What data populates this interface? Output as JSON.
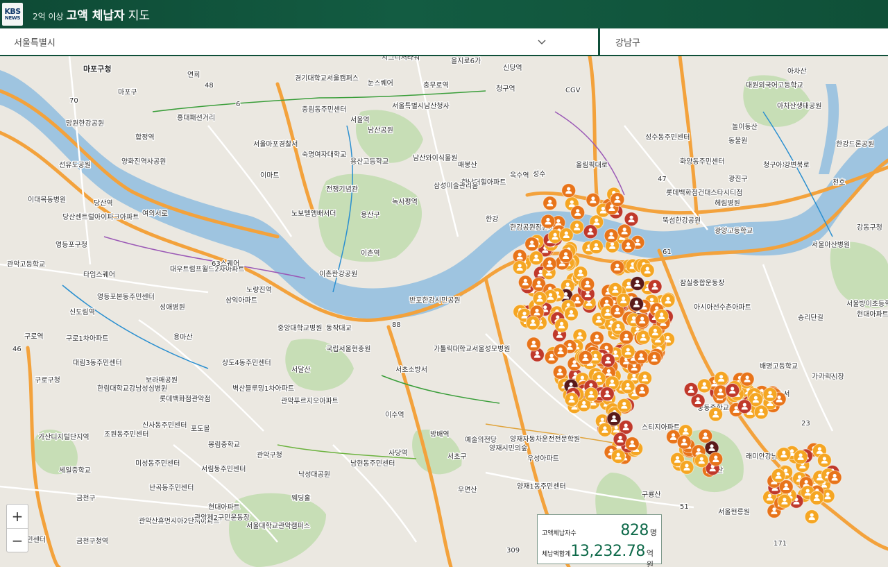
{
  "header": {
    "logo_line1": "KBS",
    "logo_line2": "NEWS",
    "title_pre": "2억 이상",
    "title_main": "고액 체납자",
    "title_post": "지도"
  },
  "filters": {
    "city": "서울특별시",
    "district": "강남구"
  },
  "summary": {
    "count_label": "고액체납자수",
    "count_value": "828",
    "count_unit": "명",
    "amount_label": "체납액합계",
    "amount_value": "13,232.78",
    "amount_unit": "억원"
  },
  "zoom": {
    "in": "+",
    "out": "−"
  },
  "colors": {
    "header": "#135c42",
    "river": "#9fc3e0",
    "marker_orange": "#f5a623",
    "marker_dark_orange": "#e8741a",
    "marker_red": "#c0392b",
    "marker_dark": "#5a1a1a",
    "highway": "#f39c32",
    "park": "#c9dfb8"
  },
  "map_labels": [
    "마포구청",
    "마포구",
    "홍대패션거리",
    "합정역",
    "망원한강공원",
    "선유도공원",
    "양화진역사공원",
    "당산역",
    "이대목동병원",
    "여의서로",
    "영등포구청",
    "당산센트럴아이파크아파트",
    "관악고등학교",
    "타임스퀘어",
    "신도림역",
    "영등포본동주민센터",
    "성애병원",
    "대우트럼프월드2차아파트",
    "63스퀘어",
    "노량진역",
    "삼익아파트",
    "중앙대학교병원",
    "용마산",
    "구로역",
    "구로1차아파트",
    "대림3동주민센터",
    "구로구청",
    "한림대학교강남성심병원",
    "보라매공원",
    "상도4동주민센터",
    "서달산",
    "벽산블루밍1차아파트",
    "관악푸르지오아파트",
    "롯데백화점관악점",
    "신사동주민센터",
    "조원동주민센터",
    "가산디지털단지역",
    "포도몰",
    "봉림중학교",
    "관악구청",
    "미성동주민센터",
    "서림동주민센터",
    "난곡동주민센터",
    "세일중학교",
    "금천구",
    "관악산휴먼시아2단지아파트",
    "관악제2구민운동장",
    "서울대학교관악캠퍼스",
    "웨딩홀",
    "현대아파트",
    "금천구청역",
    "동주민센터",
    "남현동주민센터",
    "사당역",
    "낙성대공원",
    "연희",
    "경기대학교서울캠퍼스",
    "시그니처타워",
    "신당역",
    "을지로6가",
    "충무로역",
    "청구역",
    "CGV",
    "눈스퀘어",
    "서울역",
    "서울특별시남산청사",
    "중림동주민센터",
    "남산공원",
    "서울마포경찰서",
    "숙명여자대학교",
    "이마트",
    "용산고등학교",
    "남산와이식물원",
    "매봉산",
    "한남더힐아파트",
    "삼성미술관리움",
    "옥수역",
    "성수",
    "전쟁기념관",
    "녹사평역",
    "용산구",
    "노보텔앰배서더",
    "이촌역",
    "이촌한강공원",
    "반포한강시민공원",
    "동작대교",
    "국립서울현충원",
    "서초소방서",
    "가톨릭대학교서울성모병원",
    "이수역",
    "방배역",
    "예술의전당",
    "서초구",
    "우면산",
    "양재시민의숲",
    "양재자동차운전전문학원",
    "우성아파트",
    "양재1동주민센터",
    "구룡산",
    "대모산",
    "서울현릉원",
    "수서",
    "일원동",
    "중동중학교",
    "대명중학교",
    "래미안강남포레아파트",
    "스티지아파트",
    "가락시장",
    "송리단길",
    "잠실종합운동장",
    "아시아선수촌아파트",
    "한강공원잠원지구",
    "뚝섬한강공원",
    "광양고등학교",
    "롯데백화점건대스타시티점",
    "헤림병원",
    "광진구",
    "성수동주민센터",
    "화양동주민센터",
    "아차산",
    "대원외국어고등학교",
    "아차산생태공원",
    "놀이동산",
    "동물원",
    "청구아파트",
    "한강드론공원",
    "강동구청",
    "서울아산병원",
    "서울방이초등학교",
    "현대아파트",
    "배명고등학교",
    "가락시장",
    "천호",
    "올림픽대로",
    "한강",
    "강변북로",
    "88",
    "70",
    "46",
    "48",
    "6",
    "23",
    "51",
    "61",
    "47",
    "309",
    "171"
  ]
}
